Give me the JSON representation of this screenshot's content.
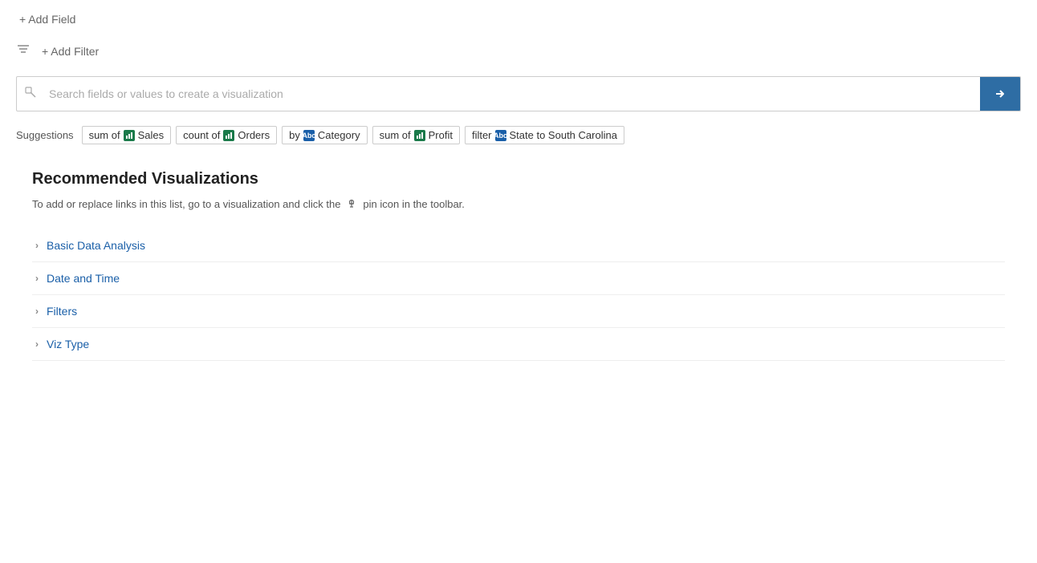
{
  "addField": {
    "label": "+ Add Field"
  },
  "filterIcon": "⊟",
  "addFilter": {
    "label": "+ Add Filter"
  },
  "search": {
    "placeholder": "Search fields or values to create a visualization"
  },
  "suggestions": {
    "label": "Suggestions",
    "chips": [
      {
        "id": "sum-sales",
        "prefix": "sum of",
        "iconType": "measure",
        "text": "Sales"
      },
      {
        "id": "count-orders",
        "prefix": "count of",
        "iconType": "measure",
        "text": "Orders"
      },
      {
        "id": "by-category",
        "prefix": "by",
        "iconType": "dim",
        "text": "Category"
      },
      {
        "id": "sum-profit",
        "prefix": "sum of",
        "iconType": "measure",
        "text": "Profit"
      },
      {
        "id": "filter-state",
        "prefix": "filter",
        "iconType": "dim",
        "text": "State to South Carolina"
      }
    ]
  },
  "recommended": {
    "title": "Recommended Visualizations",
    "description": "To add or replace links in this list, go to a visualization and click the",
    "description2": "pin icon in the toolbar.",
    "items": [
      {
        "id": "basic-data",
        "label": "Basic Data Analysis"
      },
      {
        "id": "date-time",
        "label": "Date and Time"
      },
      {
        "id": "filters",
        "label": "Filters"
      },
      {
        "id": "viz-type",
        "label": "Viz Type"
      }
    ]
  }
}
